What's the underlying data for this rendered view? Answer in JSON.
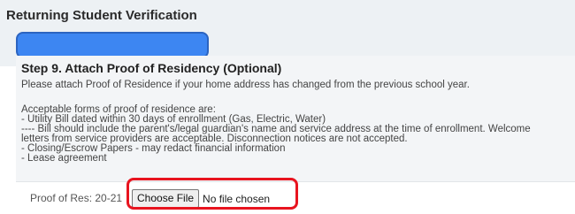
{
  "header": {
    "title": "Returning Student Verification"
  },
  "step": {
    "title": "Step 9. Attach Proof of Residency (Optional)",
    "intro": "Please attach Proof of Residence if your home address has changed from the previous school year.",
    "acceptable_heading": "Acceptable forms of proof of residence are:",
    "lines": [
      "- Utility Bill dated within 30 days of enrollment (Gas, Electric, Water)",
      "---- Bill should include the parent's/legal guardian's name and service address at the time of enrollment. Welcome",
      "letters from service providers are acceptable. Disconnection notices are not accepted.",
      "- Closing/Escrow Papers - may redact financial information",
      "- Lease agreement"
    ]
  },
  "file_field": {
    "label": "Proof of Res: 20-21",
    "button_label": "Choose File",
    "status": "No file chosen"
  },
  "colors": {
    "highlight": "#e8141f",
    "redaction": "#3d86f2",
    "panel_bg": "#f3f5f7"
  }
}
